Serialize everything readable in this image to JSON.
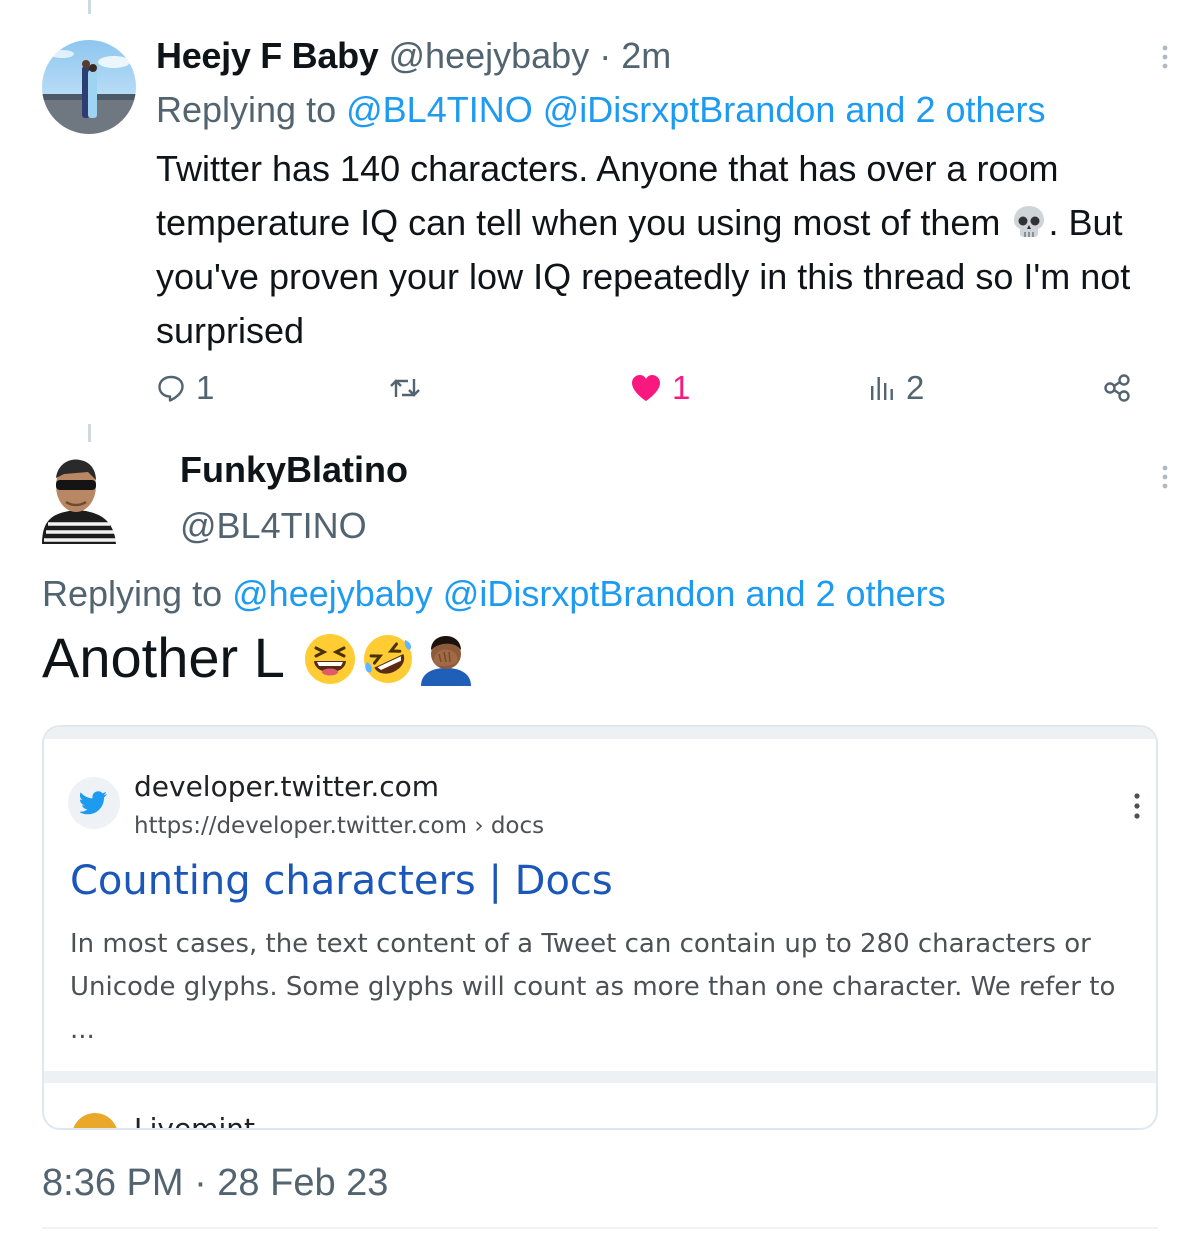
{
  "tweet1": {
    "name": "Heejy F Baby",
    "handle": "@heejybaby",
    "separator": "·",
    "time": "2m",
    "replying_to_prefix": "Replying to",
    "mentions": "@BL4TINO @iDisrxptBrandon and 2 others",
    "body_part1": "Twitter has 140 characters. Anyone that has over a room temperature IQ can tell when you using most of them",
    "body_part2": ". But you've proven your low IQ repeatedly in this thread so I'm not surprised",
    "emoji": "skull",
    "reply_count": "1",
    "like_count": "1",
    "view_count": "2",
    "accent_color": "#1d9bf0",
    "like_color": "#f91880"
  },
  "tweet2": {
    "name": "FunkyBlatino",
    "handle": "@BL4TINO",
    "replying_to_prefix": "Replying to",
    "mentions": "@heejybaby @iDisrxptBrandon and 2 others",
    "body": "Another L",
    "emojis": [
      "grinning-squinting-face",
      "rolling-on-the-floor-laughing",
      "person-facepalming"
    ]
  },
  "search_card": {
    "site_name": "developer.twitter.com",
    "site_url": "https://developer.twitter.com › docs",
    "title": "Counting characters | Docs",
    "snippet": "In most cases, the text content of a Tweet can contain up to 280 characters or Unicode glyphs. Some glyphs will count as more than one character. We refer to ...",
    "next_site_name": "Livemint",
    "title_color": "#1a57b8"
  },
  "footer": {
    "timestamp": "8:36 PM · 28 Feb 23"
  }
}
